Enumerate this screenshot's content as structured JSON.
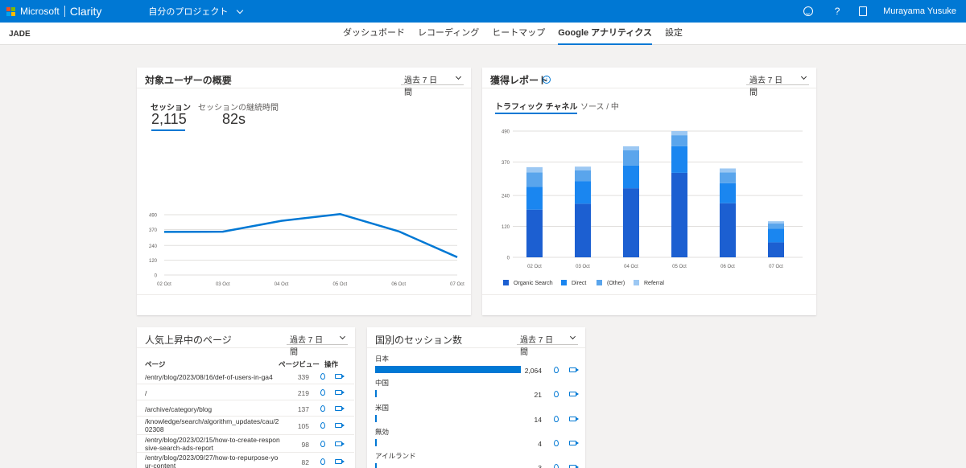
{
  "brand": {
    "company": "Microsoft",
    "product": "Clarity",
    "colors": [
      "#f25022",
      "#7fba00",
      "#00a4ef",
      "#ffb900"
    ]
  },
  "project": {
    "label": "自分のプロジェクト"
  },
  "topbar": {
    "help": "?",
    "user": "Murayama Yusuke",
    "icons": [
      "feedback-smile-icon",
      "help-icon",
      "document-icon"
    ]
  },
  "app": {
    "name": "JADE"
  },
  "tabs": [
    {
      "label": "ダッシュボード"
    },
    {
      "label": "レコーディング"
    },
    {
      "label": "ヒートマップ"
    },
    {
      "label": "Google アナリティクス"
    },
    {
      "label": "設定"
    }
  ],
  "active_tab": 3,
  "audience": {
    "title": "対象ユーザーの概要",
    "period": "過去 7 日間",
    "metrics": [
      {
        "label": "セッション",
        "value": "2,115"
      },
      {
        "label": "セッションの継続時間",
        "value": "82s"
      }
    ]
  },
  "acquisition": {
    "title": "獲得レポート",
    "info": "i",
    "period": "過去 7 日間",
    "subtabs": [
      "トラフィック チャネル",
      "ソース / 中"
    ]
  },
  "trending": {
    "title": "人気上昇中のページ",
    "period": "過去 7 日間",
    "headers": {
      "page": "ページ",
      "views": "ページビュー",
      "actions": "操作"
    },
    "rows": [
      {
        "url": "/entry/blog/2023/08/16/def-of-users-in-ga4",
        "views": "339"
      },
      {
        "url": "/",
        "views": "219"
      },
      {
        "url": "/archive/category/blog",
        "views": "137"
      },
      {
        "url": "/knowledge/search/algorithm_updates/cau/202308",
        "views": "105"
      },
      {
        "url": "/entry/blog/2023/02/15/how-to-create-responsive-search-ads-report",
        "views": "98"
      },
      {
        "url": "/entry/blog/2023/09/27/how-to-repurpose-your-content",
        "views": "82"
      }
    ]
  },
  "countries": {
    "title": "国別のセッション数",
    "period": "過去 7 日間",
    "rows": [
      {
        "name": "日本",
        "value": "2,064",
        "share": 1.0
      },
      {
        "name": "中国",
        "value": "21",
        "share": 0.0102
      },
      {
        "name": "米国",
        "value": "14",
        "share": 0.0068
      },
      {
        "name": "無効",
        "value": "4",
        "share": 0.002
      },
      {
        "name": "アイルランド",
        "value": "3",
        "share": 0.0015
      }
    ]
  },
  "chart_data": [
    {
      "type": "line",
      "x": [
        "02 Oct",
        "03 Oct",
        "04 Oct",
        "05 Oct",
        "06 Oct",
        "07 Oct"
      ],
      "series": [
        {
          "values": [
            350,
            352,
            440,
            495,
            355,
            145
          ]
        }
      ],
      "yticks": [
        0,
        120,
        240,
        370,
        490
      ],
      "ylim": [
        0,
        490
      ],
      "grid": true,
      "color": "#0078d4"
    },
    {
      "type": "bar",
      "stacked": true,
      "categories": [
        "02 Oct",
        "03 Oct",
        "04 Oct",
        "05 Oct",
        "06 Oct",
        "07 Oct"
      ],
      "series": [
        {
          "name": "Organic Search",
          "color": "#1c5fd1",
          "values": [
            185,
            208,
            268,
            328,
            210,
            58
          ]
        },
        {
          "name": "Direct",
          "color": "#1a86f0",
          "values": [
            88,
            88,
            88,
            103,
            78,
            53
          ]
        },
        {
          "name": "(Other)",
          "color": "#5aa5ec",
          "values": [
            57,
            42,
            60,
            43,
            42,
            20
          ]
        },
        {
          "name": "Referral",
          "color": "#9cc8f3",
          "values": [
            20,
            14,
            15,
            16,
            15,
            9
          ]
        }
      ],
      "yticks": [
        0,
        120,
        240,
        370,
        490
      ],
      "ylim": [
        0,
        490
      ],
      "legend": "bottom",
      "grid": true
    }
  ]
}
